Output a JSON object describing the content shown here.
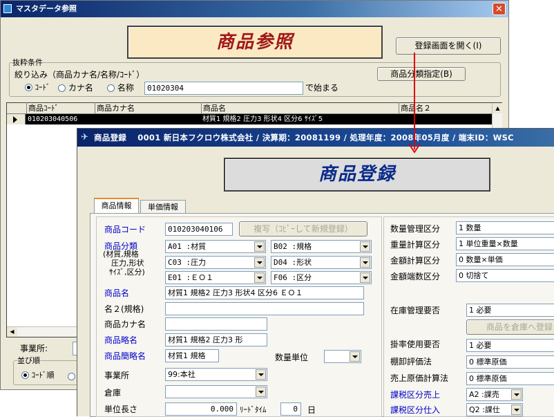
{
  "back_window": {
    "title": "マスタデータ参照",
    "heading": "商品参照",
    "open_register_button": "登録画面を開く(I)",
    "filter_group_label": "抜粋条件",
    "filter_label": "絞り込み（商品カナ名/名称/ｺｰﾄﾞ）",
    "radio_code": "ｺｰﾄﾞ",
    "radio_kana": "カナ名",
    "radio_name": "名称",
    "search_value": "01020304",
    "starts_with": "で始まる",
    "category_button": "商品分類指定(B)",
    "grid_headers": [
      "商品ｺｰﾄﾞ",
      "商品カナ名",
      "商品名",
      "商品名２"
    ],
    "grid_row": {
      "code": "010203040506",
      "kana": "",
      "name": "材質1 規格2 圧力3 形状4 区分6 ｻｲｽﾞ5",
      "name2": ""
    },
    "office_label": "事業所:",
    "sort_group_label": "並び順",
    "sort_code_label": "ｺｰﾄﾞ順"
  },
  "front_window": {
    "title": "商品登録　 0001 新日本フクロウ株式会社 / 決算期：20081199 / 処理年度：2008年05月度 / 端末ID：WSC",
    "heading": "商品登録",
    "tabs": [
      "商品情報",
      "単価情報"
    ],
    "left": {
      "code_label": "商品コード",
      "code_value": "010203040106",
      "copy_button": "複写（ｺﾋﾟｰして新規登録）",
      "category_label": "商品分類",
      "category_sub1": "(材質,規格",
      "category_sub2": "圧力,形状",
      "category_sub3": "ｻｲｽﾞ,区分)",
      "combos": [
        "A01 :材質",
        "B02 :規格",
        "C03 :圧力",
        "D04 :形状",
        "E01 :ＥＯ１",
        "F06 :区分"
      ],
      "name_label": "商品名",
      "name_value": "材質1 規格2 圧力3 形状4 区分6 ＥＯ１",
      "name2_label": "名２(規格)",
      "kana_label": "商品カナ名",
      "short_label": "商品略名",
      "short_value": "材質1 規格2 圧力3 形",
      "shorter_label": "商品簡略名",
      "shorter_value": "材質1 規格",
      "qty_unit_label": "数量単位",
      "office_label": "事業所",
      "office_value": "99:本社",
      "warehouse_label": "倉庫",
      "unit_length_label": "単位長さ",
      "unit_length_value": "0.000",
      "leadtime_label": "ﾘｰﾄﾞﾀｲﾑ",
      "leadtime_value": "0",
      "day_label": "日"
    },
    "right": {
      "rows": [
        {
          "label": "数量管理区分",
          "value": "1  数量"
        },
        {
          "label": "重量計算区分",
          "value": "1  単位重量×数量"
        },
        {
          "label": "金額計算区分",
          "value": "0  数量×単価"
        },
        {
          "label": "金額端数区分",
          "value": "0  切捨て"
        }
      ],
      "stock_label": "在庫管理要否",
      "stock_value": "1  必要",
      "stock_button": "商品を倉庫へ登録",
      "rate_label": "掛率使用要否",
      "rate_value": "1  必要",
      "eval_label": "棚卸評価法",
      "eval_value": "0  標準原価",
      "cost_label": "売上原価計算法",
      "cost_value": "0  標準原価",
      "tax_sales_label": "課税区分売上",
      "tax_sales_value": "A2 :課売",
      "tax_purchase_label": "課税区分仕入",
      "tax_purchase_value": "Q2 :課仕"
    }
  },
  "colors": {
    "titlebar": "#0a246a",
    "arrow": "#e00000",
    "heading_text": "#a01818",
    "heading2_text": "#0a2a8a"
  }
}
